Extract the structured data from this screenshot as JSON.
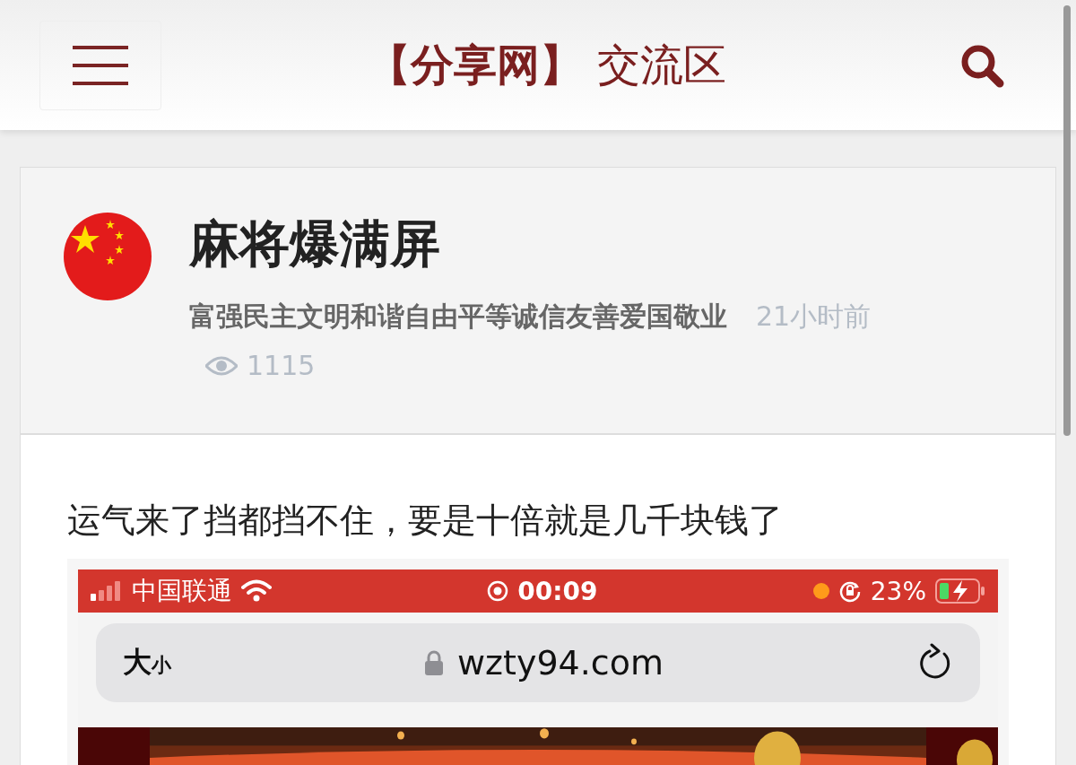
{
  "header": {
    "title": "**【分享网】** 交流区"
  },
  "post": {
    "title": "麻将爆满屏",
    "author": "富强民主文明和谐自由平等诚信友善爱国敬业",
    "time": "21小时前",
    "views": "1115",
    "body": "运气来了挡都挡不住，要是十倍就是几千块钱了"
  },
  "screenshot": {
    "status_bar": {
      "carrier": "中国联通",
      "time": "00:09",
      "battery": "23%"
    },
    "address_bar": {
      "text_size_big": "大",
      "text_size_small": "小",
      "url": "wzty94.com"
    }
  }
}
